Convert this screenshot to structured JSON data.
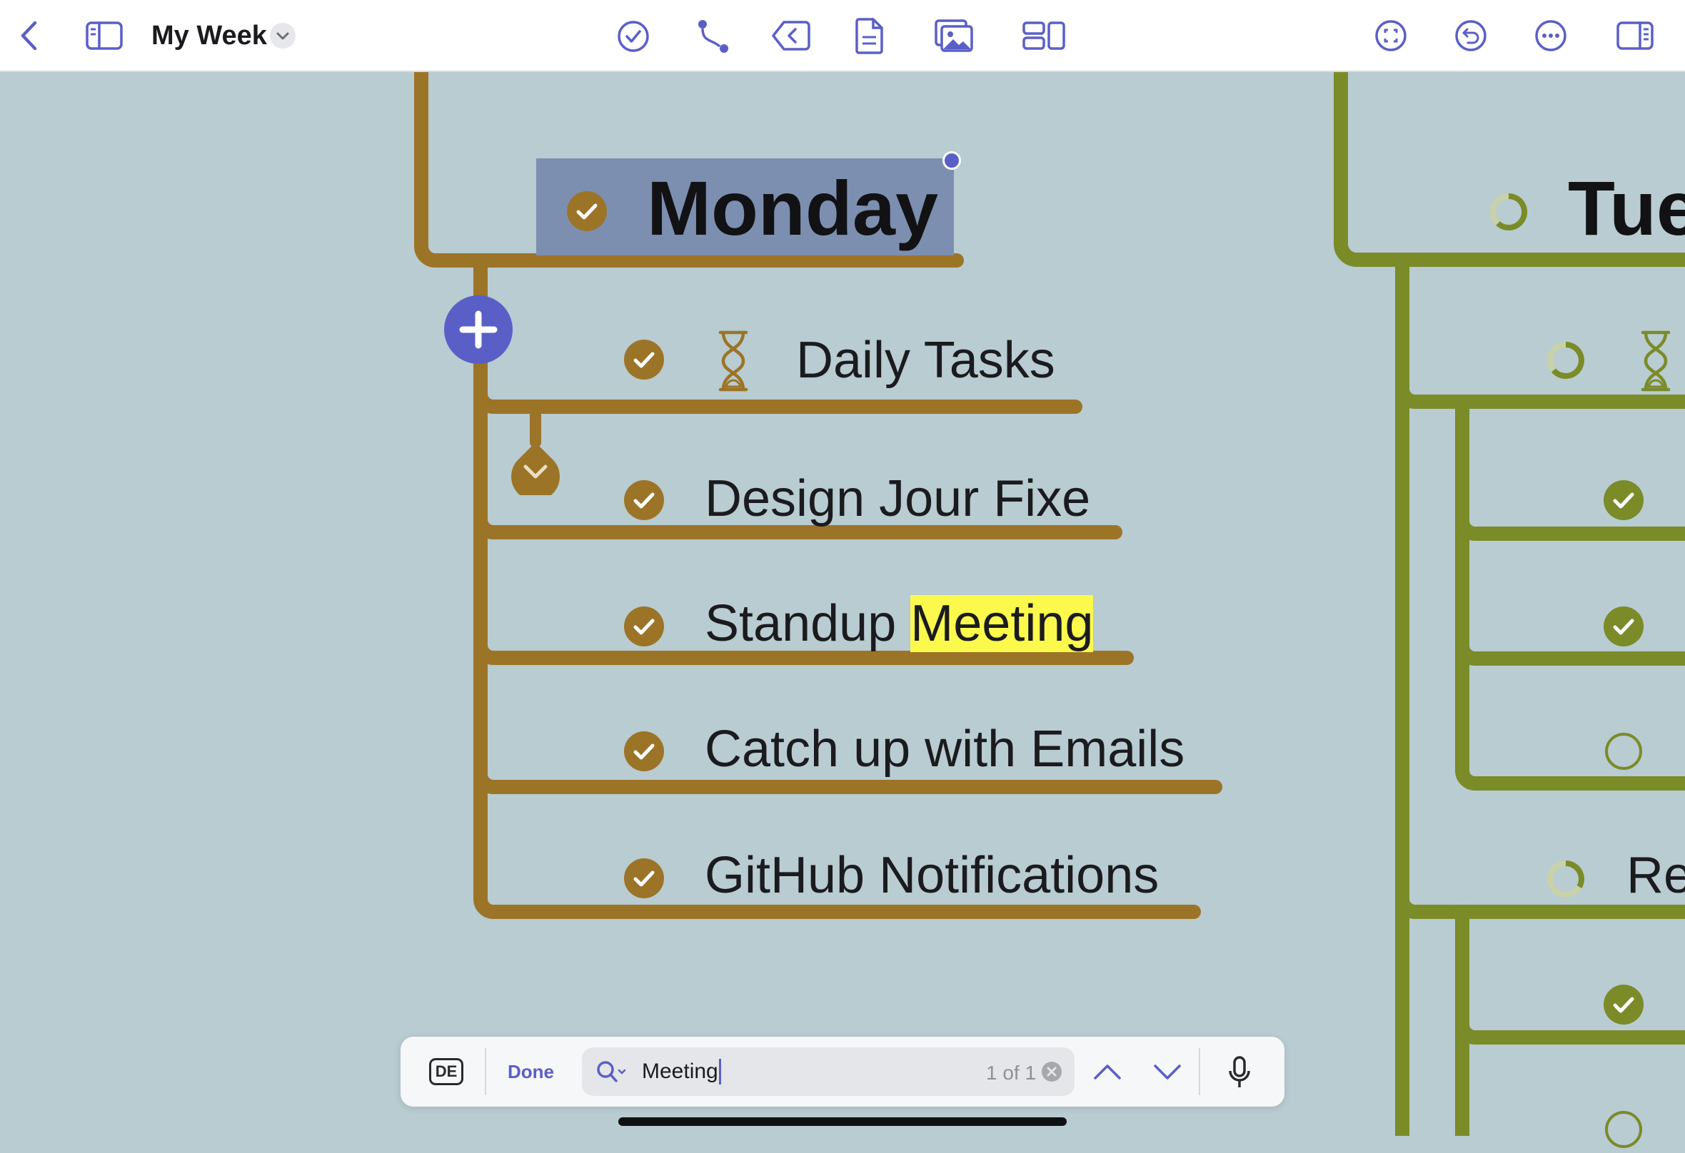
{
  "toolbar": {
    "title": "My Week",
    "icons": [
      "back-chevron-icon",
      "sidebar-left-icon",
      "task-check-icon",
      "connector-icon",
      "tag-back-icon",
      "document-icon",
      "images-icon",
      "layout-icon",
      "focus-icon",
      "undo-icon",
      "more-icon",
      "inspector-icon"
    ]
  },
  "mindmap": {
    "monday": {
      "title": "Monday",
      "items": [
        {
          "text": "Daily Tasks",
          "done": true,
          "has_hourglass": true
        },
        {
          "text_before": "Design Jour Fixe",
          "done": true
        },
        {
          "text_before": "Standup ",
          "highlight": "Meeting",
          "done": true
        },
        {
          "text_before": "Catch up with Emails",
          "done": true
        },
        {
          "text_before": "GitHub Notifications",
          "done": true
        }
      ]
    },
    "tuesday": {
      "title": "Tue",
      "partial_label": "Re"
    }
  },
  "colors": {
    "monday_branch": "#9c7427",
    "tuesday_branch": "#7a8b28",
    "selection": "#7d8fb0",
    "accent": "#5a5fc7",
    "highlight": "#fbf94c"
  },
  "findbar": {
    "keyboard_label": "DE",
    "done_label": "Done",
    "query": "Meeting",
    "match_count": "1 of 1"
  }
}
